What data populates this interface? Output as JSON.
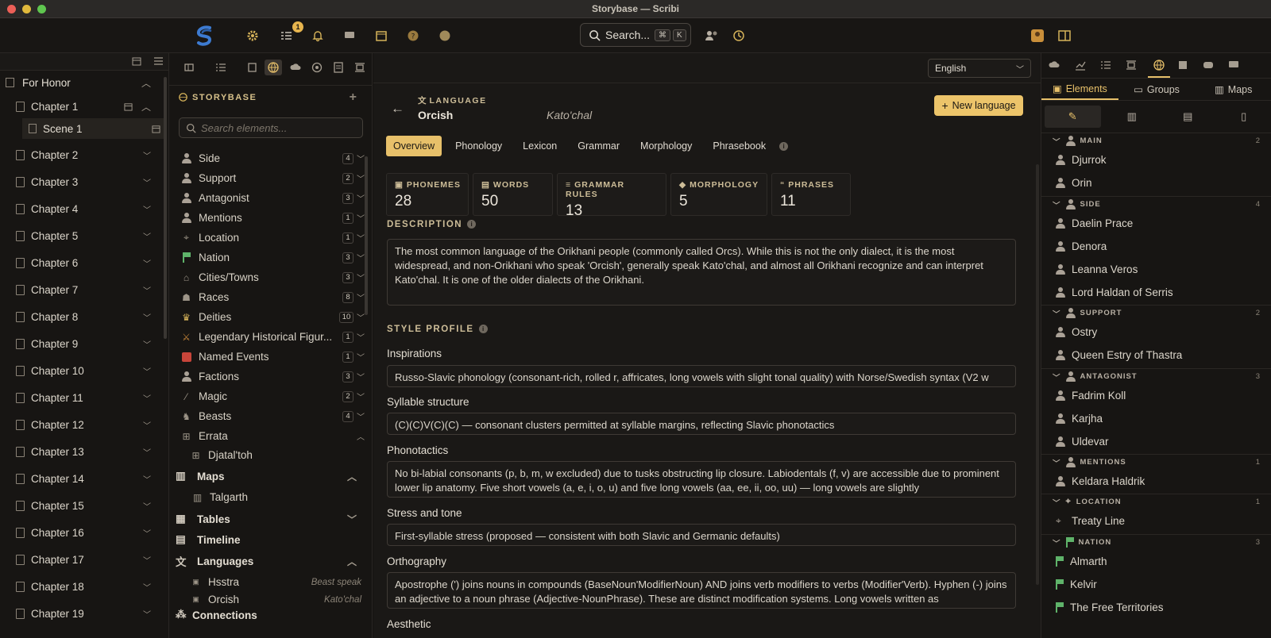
{
  "window": {
    "title": "Storybase — Scribi"
  },
  "toolbar": {
    "notification_count": "1",
    "search_label": "Search...",
    "shortcut_mod": "⌘",
    "shortcut_key": "K"
  },
  "project": {
    "name": "For Honor"
  },
  "chapters": {
    "c1": "Chapter 1",
    "scene1": "Scene 1",
    "c2": "Chapter 2",
    "c3": "Chapter 3",
    "c4": "Chapter 4",
    "c5": "Chapter 5",
    "c6": "Chapter 6",
    "c7": "Chapter 7",
    "c8": "Chapter 8",
    "c9": "Chapter 9",
    "c10": "Chapter 10",
    "c11": "Chapter 11",
    "c12": "Chapter 12",
    "c13": "Chapter 13",
    "c14": "Chapter 14",
    "c15": "Chapter 15",
    "c16": "Chapter 16",
    "c17": "Chapter 17",
    "c18": "Chapter 18",
    "c19": "Chapter 19"
  },
  "storybase": {
    "title": "STORYBASE",
    "search_placeholder": "Search elements...",
    "side": {
      "label": "Side",
      "count": "4"
    },
    "support": {
      "label": "Support",
      "count": "2"
    },
    "antagonist": {
      "label": "Antagonist",
      "count": "3"
    },
    "mentions": {
      "label": "Mentions",
      "count": "1"
    },
    "location": {
      "label": "Location",
      "count": "1"
    },
    "nation": {
      "label": "Nation",
      "count": "3"
    },
    "cities": {
      "label": "Cities/Towns",
      "count": "3"
    },
    "races": {
      "label": "Races",
      "count": "8"
    },
    "deities": {
      "label": "Deities",
      "count": "10"
    },
    "legendary": {
      "label": "Legendary Historical Figur...",
      "count": "1"
    },
    "named_events": {
      "label": "Named Events",
      "count": "1"
    },
    "factions": {
      "label": "Factions",
      "count": "3"
    },
    "magic": {
      "label": "Magic",
      "count": "2"
    },
    "beasts": {
      "label": "Beasts",
      "count": "4"
    },
    "errata": {
      "label": "Errata",
      "child": "Djatal'toh"
    },
    "maps": {
      "label": "Maps",
      "child": "Talgarth"
    },
    "tables": {
      "label": "Tables"
    },
    "timeline": {
      "label": "Timeline"
    },
    "languages": {
      "label": "Languages",
      "l1": "Hsstra",
      "l1_alt": "Beast speak",
      "l2": "Orcish",
      "l2_alt": "Kato'chal"
    },
    "connections": {
      "label": "Connections"
    }
  },
  "language": {
    "selector": "English",
    "label": "LANGUAGE",
    "name": "Orcish",
    "alt_name": "Kato'chal",
    "new_button": "New language",
    "tabs": {
      "overview": "Overview",
      "phonology": "Phonology",
      "lexicon": "Lexicon",
      "grammar": "Grammar",
      "morphology": "Morphology",
      "phrasebook": "Phrasebook"
    },
    "stats": {
      "phonemes": {
        "label": "PHONEMES",
        "value": "28"
      },
      "words": {
        "label": "WORDS",
        "value": "50"
      },
      "grammar": {
        "label": "GRAMMAR RULES",
        "value": "13"
      },
      "morphology": {
        "label": "MORPHOLOGY",
        "value": "5"
      },
      "phrases": {
        "label": "PHRASES",
        "value": "11"
      }
    },
    "description_label": "DESCRIPTION",
    "description": "The most common language of the Orikhani people (commonly called Orcs). While this is not the only dialect, it is the most widespread, and non-Orikhani who speak 'Orcish', generally speak Kato'chal, and almost all Orikhani recognize and can interpret Kato'chal. It is one of the older dialects of the Orikhani.",
    "style_label": "STYLE PROFILE",
    "inspirations_label": "Inspirations",
    "inspirations": "Russo-Slavic phonology (consonant-rich, rolled r, affricates, long vowels with slight tonal quality) with Norse/Swedish syntax (V2 w",
    "syllable_label": "Syllable structure",
    "syllable": "(C)(C)V(C)(C) — consonant clusters permitted at syllable margins, reflecting Slavic phonotactics",
    "phonotactics_label": "Phonotactics",
    "phonotactics": "No bi-labial consonants (p, b, m, w excluded) due to tusks obstructing lip closure. Labiodentals (f, v) are accessible due to prominent lower lip anatomy. Five short vowels (a, e, i, o, u) and five long vowels (aa, ee, ii, oo, uu) — long vowels are slightly",
    "stress_label": "Stress and tone",
    "stress": "First-syllable stress (proposed — consistent with both Slavic and Germanic defaults)",
    "orthography_label": "Orthography",
    "orthography": "Apostrophe (') joins nouns in compounds (BaseNoun'ModifierNoun) AND joins verb modifiers to verbs (Modifier'Verb). Hyphen (-) joins an adjective to a noun phrase (Adjective-NounPhrase). These are distinct modification systems. Long vowels written as",
    "aesthetic_label": "Aesthetic"
  },
  "right": {
    "tabs": {
      "elements": "Elements",
      "groups": "Groups",
      "maps": "Maps"
    },
    "main": {
      "label": "MAIN",
      "count": "2",
      "i1": "Djurrok",
      "i2": "Orin"
    },
    "side": {
      "label": "SIDE",
      "count": "4",
      "i1": "Daelin Prace",
      "i2": "Denora",
      "i3": "Leanna Veros",
      "i4": "Lord Haldan of Serris"
    },
    "support": {
      "label": "SUPPORT",
      "count": "2",
      "i1": "Ostry",
      "i2": "Queen Estry of Thastra"
    },
    "antagonist": {
      "label": "ANTAGONIST",
      "count": "3",
      "i1": "Fadrim Koll",
      "i2": "Karjha",
      "i3": "Uldevar"
    },
    "mentions": {
      "label": "MENTIONS",
      "count": "1",
      "i1": "Keldara Haldrik"
    },
    "location": {
      "label": "LOCATION",
      "count": "1",
      "i1": "Treaty Line"
    },
    "nation": {
      "label": "NATION",
      "count": "3",
      "i1": "Almarth",
      "i2": "Kelvir",
      "i3": "The Free Territories"
    }
  },
  "colors": {
    "accent": "#e7c06a",
    "background": "#1a1816",
    "nation_flag": "#5fb36a"
  }
}
